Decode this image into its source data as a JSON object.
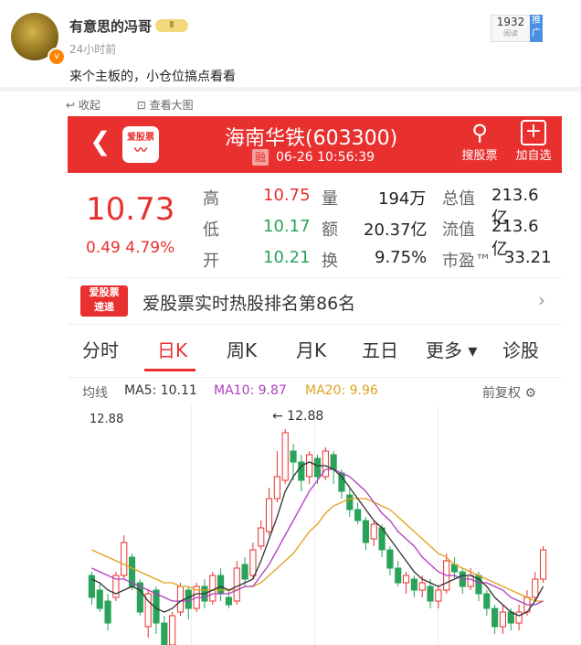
{
  "post": {
    "username": "有意思的冯哥",
    "vip": "Ⅱ",
    "time": "24小时前",
    "views": "1932",
    "views_label": "阅读",
    "promote": "推广",
    "text": "来个主板的，小仓位搞点看看",
    "collapse": "收起",
    "view_large": "查看大图"
  },
  "app": {
    "logo": "爱股票",
    "stock_title": "海南华铁(603300)",
    "rong": "融",
    "datetime": "06-26 10:56:39",
    "search_label": "搜股票",
    "add_label": "加自选"
  },
  "quote": {
    "price": "10.73",
    "change": "0.49  4.79%",
    "rows": [
      {
        "k1": "高",
        "v1": "10.75",
        "k2": "量",
        "v2": "194万",
        "k3": "总值",
        "v3": "213.6亿"
      },
      {
        "k1": "低",
        "v1": "10.17",
        "k2": "额",
        "v2": "20.37亿",
        "k3": "流值",
        "v3": "213.6亿"
      },
      {
        "k1": "开",
        "v1": "10.21",
        "k2": "换",
        "v2": "9.75%",
        "k3": "市盈™",
        "v3": "33.21"
      }
    ]
  },
  "banner": {
    "logo_top": "爱股票",
    "logo_bottom": "速递",
    "text": "爱股票实时热股排名第86名"
  },
  "tabs": [
    "分时",
    "日K",
    "周K",
    "月K",
    "五日",
    "更多 ▾",
    "诊股"
  ],
  "ma": {
    "label": "均线",
    "ma5": "MA5: 10.11",
    "ma10": "MA10: 9.87",
    "ma20": "MA20: 9.96",
    "adjust": "前复权 ⚙",
    "colors": {
      "ma5": "#333333",
      "ma10": "#b03fc1",
      "ma20": "#e0a21c"
    }
  },
  "chart_data": {
    "type": "candlestick",
    "high_label": "12.88",
    "peak_marker": "← 12.88",
    "ylim": [
      7.0,
      13.2
    ],
    "candles": [
      [
        8.9,
        8.3,
        9.0,
        8.1
      ],
      [
        8.5,
        8.0,
        8.7,
        7.9
      ],
      [
        8.2,
        7.6,
        8.4,
        7.4
      ],
      [
        8.3,
        8.9,
        9.0,
        8.2
      ],
      [
        8.9,
        9.8,
        10.0,
        8.8
      ],
      [
        9.4,
        8.6,
        9.5,
        8.5
      ],
      [
        8.7,
        7.9,
        8.8,
        7.8
      ],
      [
        7.5,
        8.4,
        8.5,
        7.2
      ],
      [
        8.5,
        7.6,
        8.6,
        7.3
      ],
      [
        7.6,
        6.9,
        7.8,
        6.7
      ],
      [
        7.0,
        7.8,
        7.9,
        6.9
      ],
      [
        7.9,
        8.6,
        8.7,
        7.8
      ],
      [
        8.5,
        8.0,
        8.6,
        7.7
      ],
      [
        8.0,
        8.6,
        8.7,
        7.9
      ],
      [
        8.6,
        8.2,
        8.8,
        8.0
      ],
      [
        8.2,
        8.9,
        9.0,
        8.1
      ],
      [
        8.9,
        8.4,
        9.1,
        8.2
      ],
      [
        8.3,
        8.1,
        8.5,
        8.0
      ],
      [
        8.2,
        9.1,
        9.3,
        8.1
      ],
      [
        9.2,
        8.8,
        9.4,
        8.6
      ],
      [
        8.9,
        9.6,
        9.8,
        8.8
      ],
      [
        9.7,
        10.2,
        10.4,
        9.6
      ],
      [
        10.1,
        11.0,
        11.3,
        10.0
      ],
      [
        11.0,
        11.6,
        12.3,
        10.9
      ],
      [
        11.5,
        12.8,
        12.9,
        11.4
      ],
      [
        12.3,
        12.0,
        12.5,
        11.5
      ],
      [
        12.0,
        11.5,
        12.2,
        11.2
      ],
      [
        11.6,
        12.2,
        12.3,
        11.4
      ],
      [
        12.1,
        11.6,
        12.2,
        11.4
      ],
      [
        11.6,
        12.3,
        12.4,
        11.5
      ],
      [
        12.2,
        11.8,
        12.3,
        11.4
      ],
      [
        11.7,
        11.2,
        11.8,
        11.0
      ],
      [
        11.1,
        10.7,
        11.3,
        10.5
      ],
      [
        10.7,
        10.4,
        10.9,
        10.3
      ],
      [
        10.4,
        9.8,
        10.5,
        9.6
      ],
      [
        9.9,
        10.3,
        10.4,
        9.7
      ],
      [
        10.2,
        9.6,
        10.3,
        9.4
      ],
      [
        9.6,
        9.1,
        9.7,
        8.9
      ],
      [
        9.1,
        8.7,
        9.3,
        8.6
      ],
      [
        8.7,
        8.9,
        9.0,
        8.4
      ],
      [
        8.8,
        8.5,
        8.9,
        8.3
      ],
      [
        8.5,
        8.7,
        8.9,
        8.3
      ],
      [
        8.6,
        8.2,
        8.8,
        8.0
      ],
      [
        8.2,
        8.5,
        8.6,
        8.0
      ],
      [
        8.5,
        9.3,
        9.5,
        8.4
      ],
      [
        9.2,
        9.0,
        9.4,
        8.8
      ],
      [
        9.0,
        8.6,
        9.1,
        8.4
      ],
      [
        8.6,
        8.9,
        9.1,
        8.5
      ],
      [
        8.9,
        8.4,
        9.0,
        8.2
      ],
      [
        8.4,
        8.0,
        8.5,
        7.8
      ],
      [
        8.0,
        7.5,
        8.1,
        7.3
      ],
      [
        7.5,
        7.9,
        8.1,
        7.3
      ],
      [
        7.9,
        7.6,
        8.0,
        7.4
      ],
      [
        7.6,
        7.9,
        8.1,
        7.4
      ],
      [
        7.9,
        8.3,
        8.5,
        7.8
      ],
      [
        8.3,
        8.8,
        9.0,
        8.2
      ],
      [
        8.8,
        9.6,
        9.7,
        8.7
      ]
    ],
    "ma5": [
      8.8,
      8.7,
      8.5,
      8.4,
      8.5,
      8.6,
      8.5,
      8.2,
      8.0,
      7.9,
      8.0,
      8.2,
      8.3,
      8.4,
      8.4,
      8.5,
      8.6,
      8.5,
      8.6,
      8.7,
      8.8,
      9.3,
      9.9,
      10.5,
      11.2,
      11.6,
      11.9,
      12.0,
      11.9,
      11.9,
      11.8,
      11.6,
      11.3,
      11.0,
      10.7,
      10.4,
      10.2,
      9.9,
      9.6,
      9.3,
      9.0,
      8.8,
      8.7,
      8.6,
      8.7,
      8.8,
      8.9,
      8.9,
      8.8,
      8.6,
      8.3,
      8.1,
      7.9,
      7.8,
      7.9,
      8.2,
      8.6
    ],
    "ma10": [
      9.1,
      9.0,
      8.9,
      8.8,
      8.8,
      8.7,
      8.6,
      8.5,
      8.4,
      8.3,
      8.2,
      8.2,
      8.2,
      8.3,
      8.3,
      8.4,
      8.4,
      8.4,
      8.5,
      8.6,
      8.6,
      8.9,
      9.2,
      9.6,
      10.0,
      10.4,
      10.8,
      11.2,
      11.5,
      11.8,
      11.8,
      11.7,
      11.6,
      11.4,
      11.2,
      10.9,
      10.6,
      10.4,
      10.1,
      9.9,
      9.7,
      9.4,
      9.2,
      9.0,
      8.9,
      8.9,
      8.8,
      8.8,
      8.7,
      8.7,
      8.6,
      8.5,
      8.3,
      8.2,
      8.1,
      8.1,
      8.2
    ],
    "ma20": [
      9.6,
      9.5,
      9.4,
      9.3,
      9.2,
      9.1,
      9.0,
      8.9,
      8.8,
      8.7,
      8.7,
      8.6,
      8.6,
      8.5,
      8.5,
      8.5,
      8.5,
      8.5,
      8.5,
      8.6,
      8.6,
      8.7,
      8.9,
      9.1,
      9.3,
      9.5,
      9.8,
      10.1,
      10.3,
      10.6,
      10.8,
      10.9,
      11.0,
      11.0,
      11.0,
      10.9,
      10.8,
      10.7,
      10.5,
      10.3,
      10.1,
      9.9,
      9.7,
      9.5,
      9.4,
      9.2,
      9.1,
      9.0,
      8.9,
      8.8,
      8.7,
      8.6,
      8.5,
      8.4,
      8.3,
      8.2,
      8.2
    ]
  }
}
